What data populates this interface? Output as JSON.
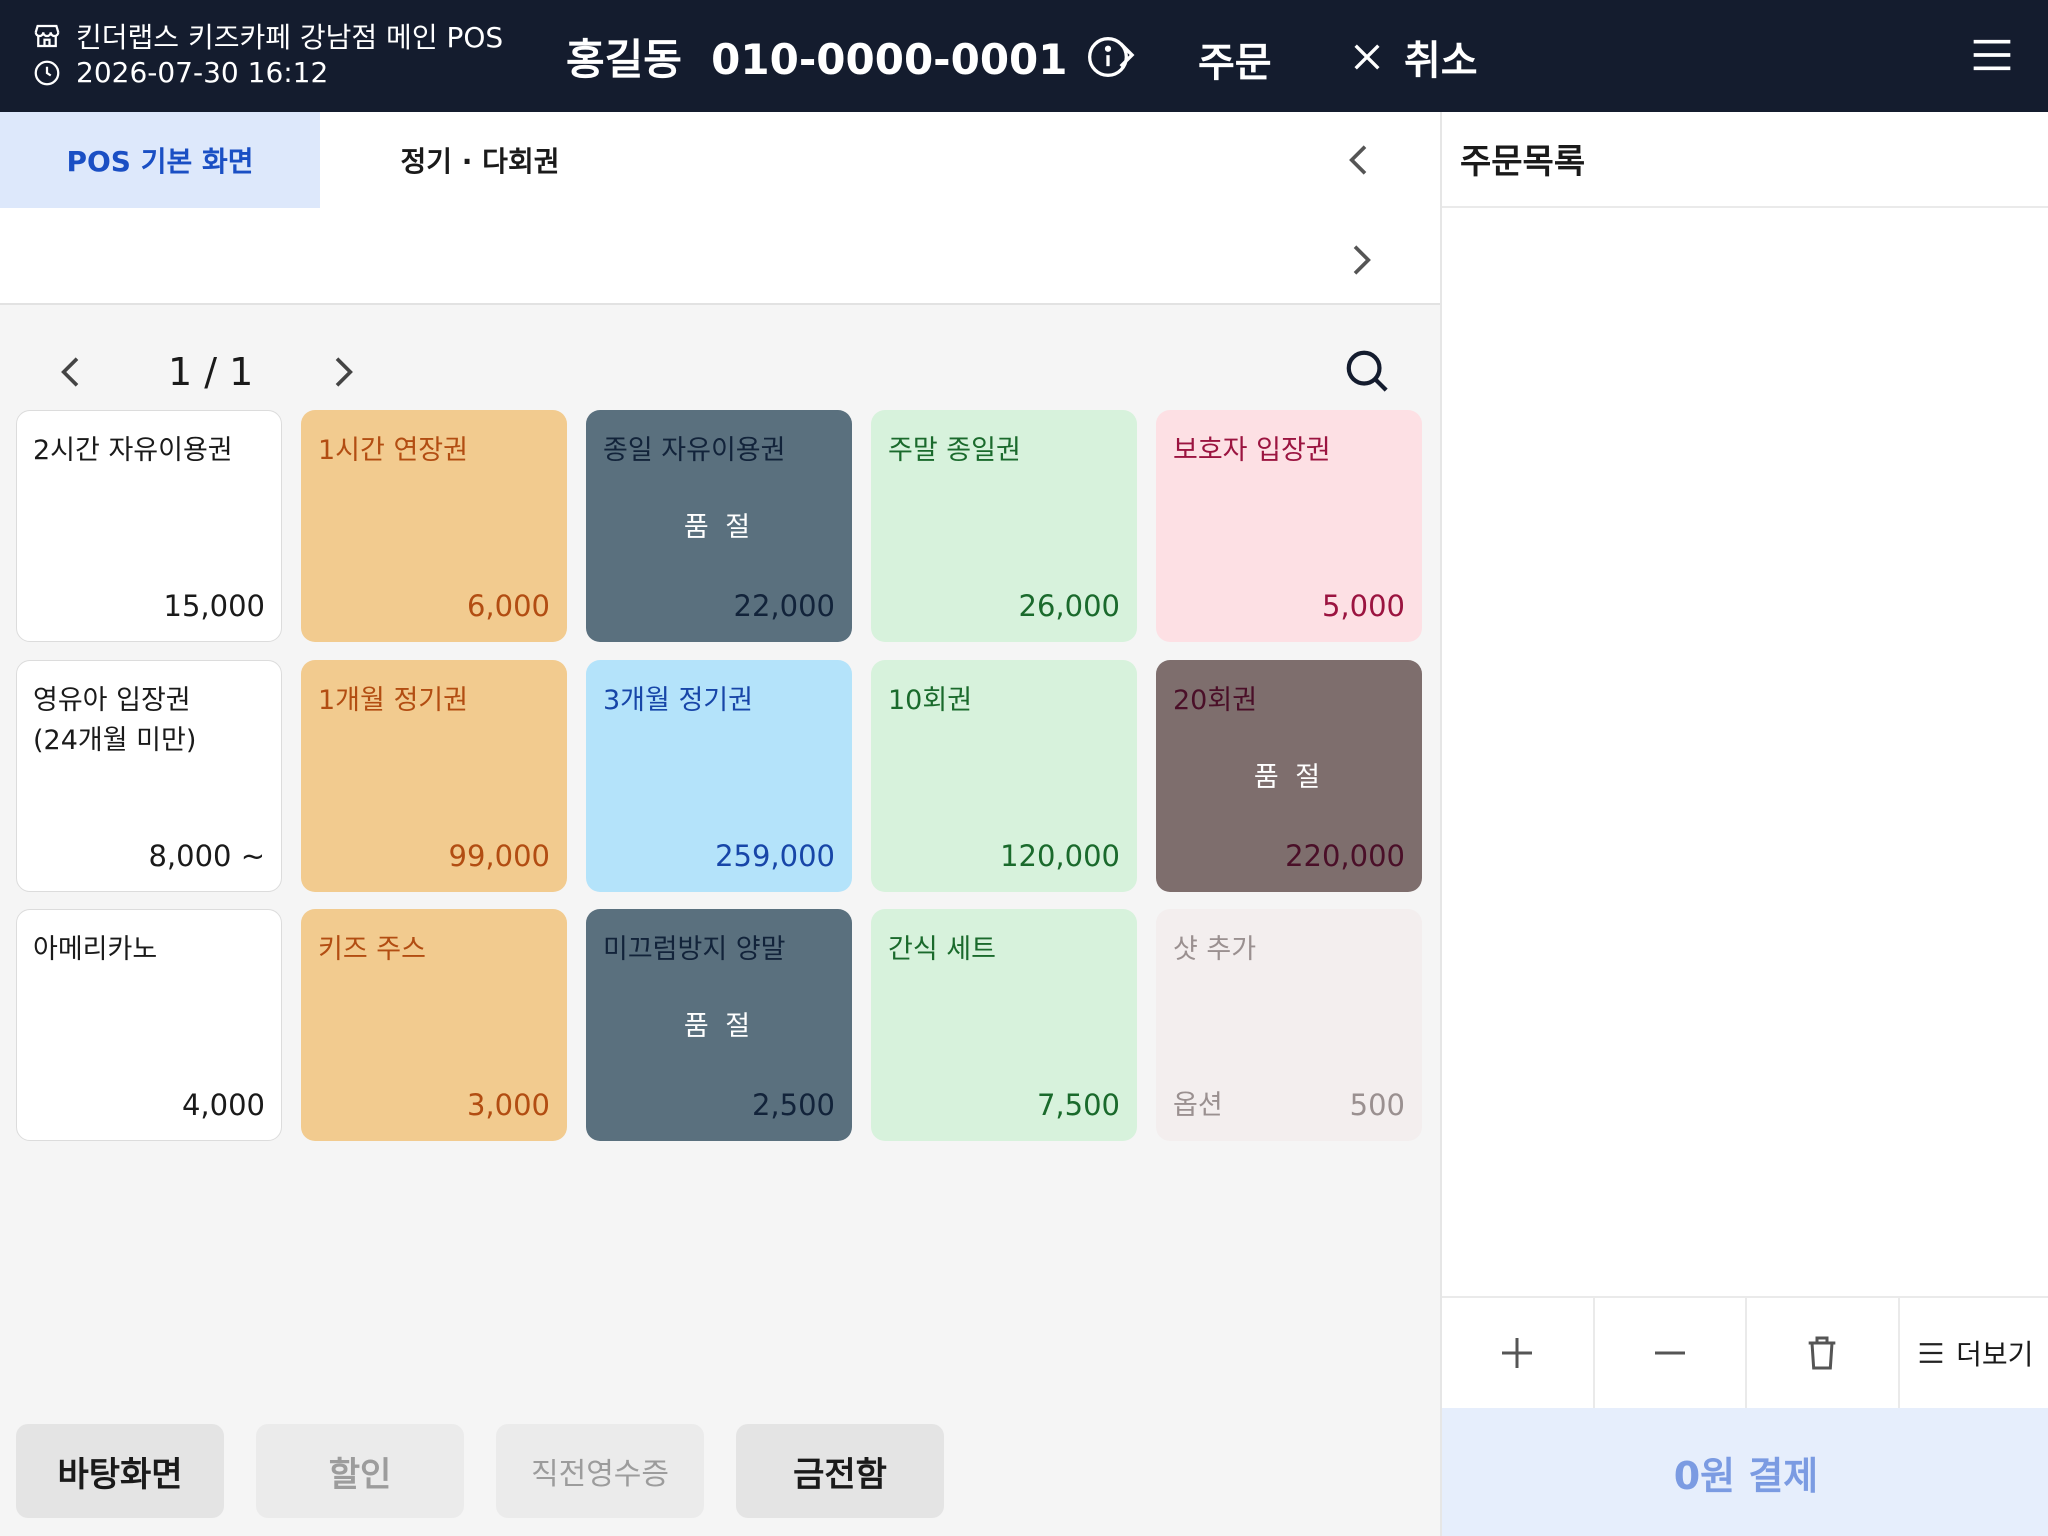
{
  "header": {
    "store_name": "킨더랩스 키즈카페 강남점 메인 POS",
    "datetime": "2026-07-30 16:12",
    "customer": "홍길동  010-0000-0001",
    "order_label": "주문",
    "cancel_label": "취소"
  },
  "tabs": [
    "POS 기본 화면",
    "정기 · 다회권"
  ],
  "pager": {
    "label": "1 / 1"
  },
  "products": [
    {
      "name": "2시간 자유이용권",
      "price": "15,000",
      "style": "white"
    },
    {
      "name": "1시간 연장권",
      "price": "6,000",
      "style": "orange"
    },
    {
      "name": "종일 자유이용권",
      "price": "22,000",
      "style": "slate",
      "sold_out": "품 절"
    },
    {
      "name": "주말 종일권",
      "price": "26,000",
      "style": "green"
    },
    {
      "name": "보호자 입장권",
      "price": "5,000",
      "style": "pink"
    },
    {
      "name": "영유아 입장권\n(24개월 미만)",
      "price": "8,000 ~",
      "style": "white"
    },
    {
      "name": "1개월 정기권",
      "price": "99,000",
      "style": "orange"
    },
    {
      "name": "3개월 정기권",
      "price": "259,000",
      "style": "blue"
    },
    {
      "name": "10회권",
      "price": "120,000",
      "style": "green"
    },
    {
      "name": "20회권",
      "price": "220,000",
      "style": "brown",
      "sold_out": "품 절"
    },
    {
      "name": "아메리카노",
      "price": "4,000",
      "style": "white"
    },
    {
      "name": "키즈 주스",
      "price": "3,000",
      "style": "orange"
    },
    {
      "name": "미끄럼방지 양말",
      "price": "2,500",
      "style": "slate",
      "sold_out": "품 절"
    },
    {
      "name": "간식 세트",
      "price": "7,500",
      "style": "green"
    },
    {
      "name": "샷 추가",
      "price": "500",
      "style": "faded",
      "option_label": "옵션"
    }
  ],
  "bottom_buttons": {
    "home": "바탕화면",
    "discount": "할인",
    "last_receipt": "직전영수증",
    "cash_drawer": "금전함"
  },
  "order_panel": {
    "title": "주문목록",
    "more_label": "더보기",
    "pay_label": "0원 결제"
  }
}
